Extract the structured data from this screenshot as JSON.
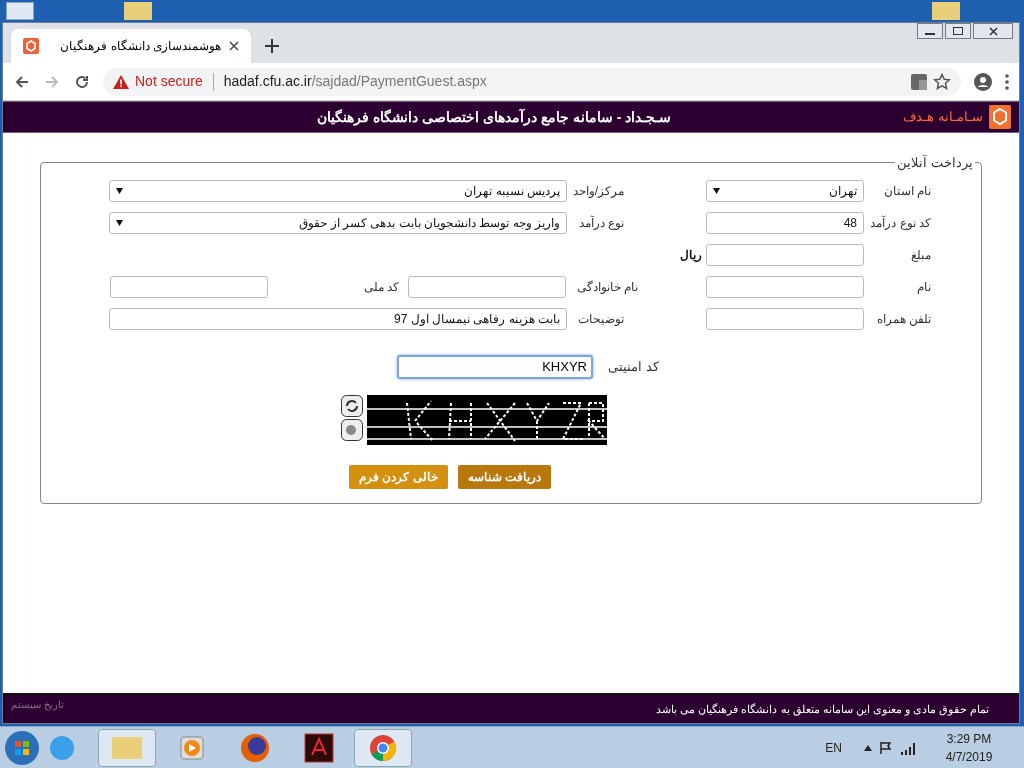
{
  "browser": {
    "tab_title": "هوشمندسازی دانشگاه فرهنگیان",
    "security": "Not secure",
    "url_host": "hadaf.cfu.ac.ir",
    "url_path": "/sajdad/PaymentGuest.aspx"
  },
  "header": {
    "logo_text": "سـامـانه هـدف",
    "title": "سـجـداد - سامانه جامع درآمدهای اختصاصی دانشگاه فرهنگیان"
  },
  "form": {
    "legend": "پرداخت آنلاین",
    "rows": [
      [
        {
          "label": "نام استان",
          "kind": "select",
          "value": "تهران"
        },
        {
          "label": "مرکز/واحد",
          "kind": "select",
          "value": "پردیس نسیبه تهران"
        }
      ],
      [
        {
          "label": "کد نوع درآمد",
          "kind": "input",
          "value": "48"
        },
        {
          "label": "نوع درآمد",
          "kind": "select",
          "value": "واریز وجه توسط دانشجویان بابت بدهی کسر از حقوق"
        }
      ],
      [
        {
          "label": "مبلغ",
          "kind": "input",
          "suffix": "ریال"
        }
      ],
      [
        {
          "label": "نام",
          "kind": "input"
        },
        {
          "label": "نام خانوادگی",
          "kind": "input"
        },
        {
          "label": "کد ملی",
          "kind": "input"
        }
      ],
      [
        {
          "label": "تلفن همراه",
          "kind": "input"
        },
        {
          "label": "توضیحات",
          "kind": "input",
          "value": "بابت هزینه رفاهی نیمسال اول 97"
        }
      ]
    ],
    "captcha": {
      "label": "کد امنیتی",
      "value": "KHXYR",
      "focused": true
    },
    "buttons": [
      {
        "label": "دریافت شناسه",
        "kind": "primary"
      },
      {
        "label": "خالی کردن فرم",
        "kind": "secondary"
      }
    ]
  },
  "footer": {
    "left": "تاریخ سیستم",
    "copyright": "تمام حقوق مادی و معنوی این سامانه متعلق به دانشگاه فرهنگیان می باشد"
  },
  "taskbar": {
    "language": "EN",
    "time": "3:29 PM",
    "date": "4/7/2019"
  }
}
